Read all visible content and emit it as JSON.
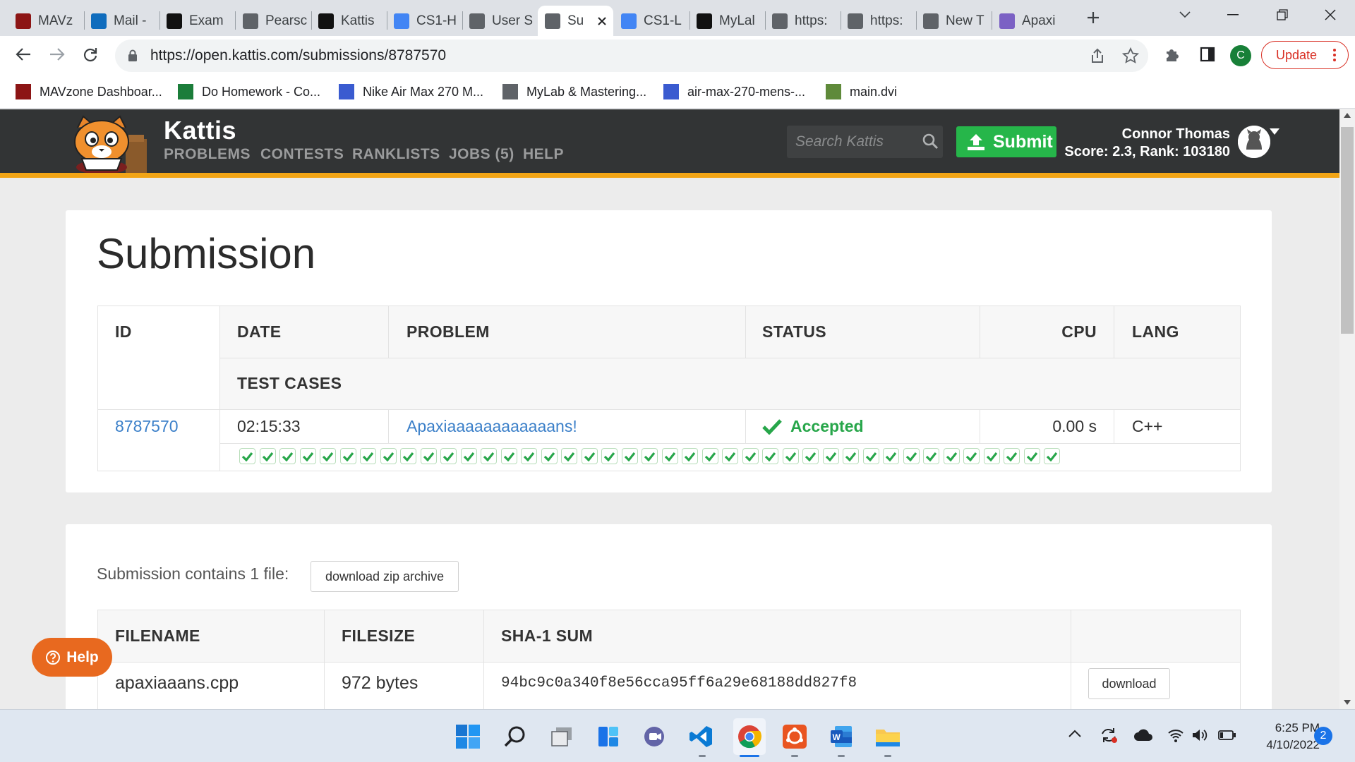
{
  "browser": {
    "tabs": [
      {
        "label": "MAVz",
        "icon": "cmu-icon",
        "color": "#8c1515"
      },
      {
        "label": "Mail -",
        "icon": "outlook-icon",
        "color": "#0f6cbd"
      },
      {
        "label": "Exam",
        "icon": "d2l-icon",
        "color": "#111111"
      },
      {
        "label": "Pearsc",
        "icon": "globe-icon",
        "color": "#5f6368"
      },
      {
        "label": "Kattis",
        "icon": "d2l-icon",
        "color": "#111111"
      },
      {
        "label": "CS1-H",
        "icon": "docs-icon",
        "color": "#4285f4"
      },
      {
        "label": "User S",
        "icon": "kattis-icon",
        "color": "#5f6368"
      },
      {
        "label": "Su",
        "icon": "kattis-icon",
        "color": "#5f6368"
      },
      {
        "label": "CS1-L",
        "icon": "docs-icon",
        "color": "#4285f4"
      },
      {
        "label": "MyLal",
        "icon": "d2l-icon",
        "color": "#111111"
      },
      {
        "label": "https:",
        "icon": "globe-icon",
        "color": "#5f6368"
      },
      {
        "label": "https:",
        "icon": "globe-icon",
        "color": "#5f6368"
      },
      {
        "label": "New T",
        "icon": "chrome-icon",
        "color": "#5f6368"
      },
      {
        "label": "Apaxi",
        "icon": "apaxian-icon",
        "color": "#7b61c4"
      }
    ],
    "active_tab": 7,
    "url": "https://open.kattis.com/submissions/8787570",
    "profile_initial": "C",
    "update_label": "Update",
    "bookmarks": [
      {
        "label": "MAVzone Dashboar...",
        "icon": "cmu-icon",
        "color": "#8c1515"
      },
      {
        "label": "Do Homework - Co...",
        "icon": "pearson-icon",
        "color": "#1b7d3a"
      },
      {
        "label": "Nike Air Max 270 M...",
        "icon": "nike-site-icon",
        "color": "#3a5bd0"
      },
      {
        "label": "MyLab & Mastering...",
        "icon": "globe-icon",
        "color": "#5f6368"
      },
      {
        "label": "air-max-270-mens-...",
        "icon": "nike-site-icon",
        "color": "#3a5bd0"
      },
      {
        "label": "main.dvi",
        "icon": "tex-icon",
        "color": "#5f8a3a"
      }
    ]
  },
  "kattis": {
    "brand": "Kattis",
    "nav": [
      "PROBLEMS",
      "CONTESTS",
      "RANKLISTS",
      "JOBS (5)",
      "HELP"
    ],
    "search_placeholder": "Search Kattis",
    "submit_label": "Submit",
    "user_name": "Connor Thomas",
    "user_score": "Score: 2.3, Rank: 103180"
  },
  "submission": {
    "title": "Submission",
    "headers": {
      "id": "ID",
      "date": "DATE",
      "problem": "PROBLEM",
      "status": "STATUS",
      "cpu": "CPU",
      "lang": "LANG",
      "test_cases": "TEST CASES"
    },
    "row": {
      "id": "8787570",
      "date": "02:15:33",
      "problem": "Apaxiaaaaaaaaaaaans!",
      "status": "Accepted",
      "cpu": "0.00 s",
      "lang": "C++"
    },
    "test_cases_passed": 41
  },
  "files": {
    "summary": "Submission contains 1 file:",
    "zip_label": "download zip archive",
    "headers": {
      "filename": "FILENAME",
      "filesize": "FILESIZE",
      "sha1": "SHA-1 SUM"
    },
    "rows": [
      {
        "filename": "apaxiaaans.cpp",
        "filesize": "972 bytes",
        "sha1": "94bc9c0a340f8e56cca95ff6a29e68188dd827f8",
        "action": "download"
      }
    ]
  },
  "help_label": "Help",
  "taskbar": {
    "time": "6:25 PM",
    "date": "4/10/2022",
    "notifications": "2"
  },
  "colors": {
    "accent_green": "#26b64a",
    "stripe": "#f2a516",
    "link": "#3c80c9",
    "help": "#e8691f"
  }
}
